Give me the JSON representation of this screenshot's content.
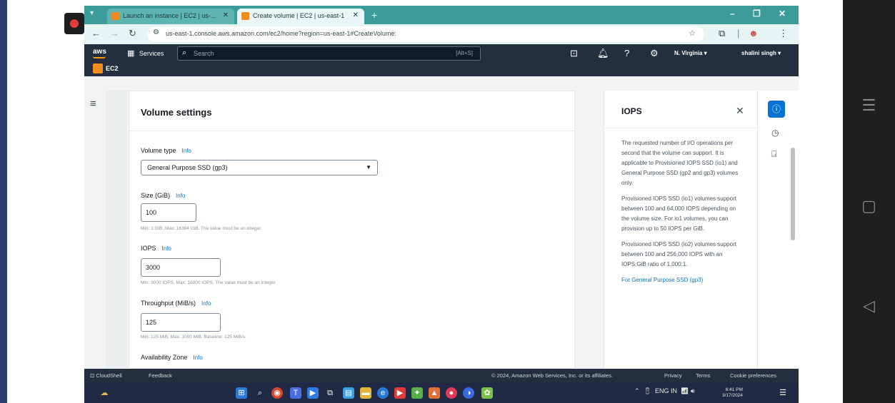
{
  "browser": {
    "tabs": [
      {
        "label": "Launch an instance | EC2 | us-..."
      },
      {
        "label": "Create volume | EC2 | us-east-1"
      }
    ],
    "url": "us-east-1.console.aws.amazon.com/ec2/home?region=us-east-1#CreateVolume:"
  },
  "aws_header": {
    "logo": "aws",
    "services_label": "Services",
    "search_placeholder": "Search",
    "search_shortcut": "[Alt+S]",
    "region": "N. Virginia ▾",
    "user": "shalini singh ▾",
    "service_name": "EC2"
  },
  "volume_settings": {
    "title": "Volume settings",
    "info_label": "Info",
    "volume_type": {
      "label": "Volume type",
      "value": "General Purpose SSD (gp3)"
    },
    "size": {
      "label": "Size (GiB)",
      "value": "100",
      "hint": "Min: 1 GiB, Max: 16384 GiB. The value must be an integer."
    },
    "iops": {
      "label": "IOPS",
      "value": "3000",
      "hint": "Min: 3000 IOPS, Max: 16000 IOPS. The value must be an integer."
    },
    "throughput": {
      "label": "Throughput (MiB/s)",
      "value": "125",
      "hint": "Min: 125 MiB, Max: 1000 MiB. Baseline: 125 MiB/s."
    },
    "availability_zone": {
      "label": "Availability Zone"
    }
  },
  "help_panel": {
    "title": "IOPS",
    "paragraphs": [
      "The requested number of I/O operations per second that the volume can support. It is applicable to Provisioned IOPS SSD (io1) and General Purpose SSD (gp2 and gp3) volumes only.",
      "Provisioned IOPS SSD (io1) volumes support between 100 and 64,000 IOPS depending on the volume size. For io1 volumes, you can provision up to 50 IOPS per GiB.",
      "Provisioned IOPS SSD (io2) volumes support between 100 and 256,000 IOPS with an IOPS:GiB ratio of 1,000:1.",
      "For General Purpose SSD (gp3)"
    ]
  },
  "footer": {
    "cloudshell": "CloudShell",
    "feedback": "Feedback",
    "copyright": "© 2024, Amazon Web Services, Inc. or its affiliates.",
    "privacy": "Privacy",
    "terms": "Terms",
    "cookies": "Cookie preferences"
  },
  "taskbar": {
    "lang": "ENG IN",
    "time": "6:41 PM",
    "date": "3/17/2024"
  }
}
